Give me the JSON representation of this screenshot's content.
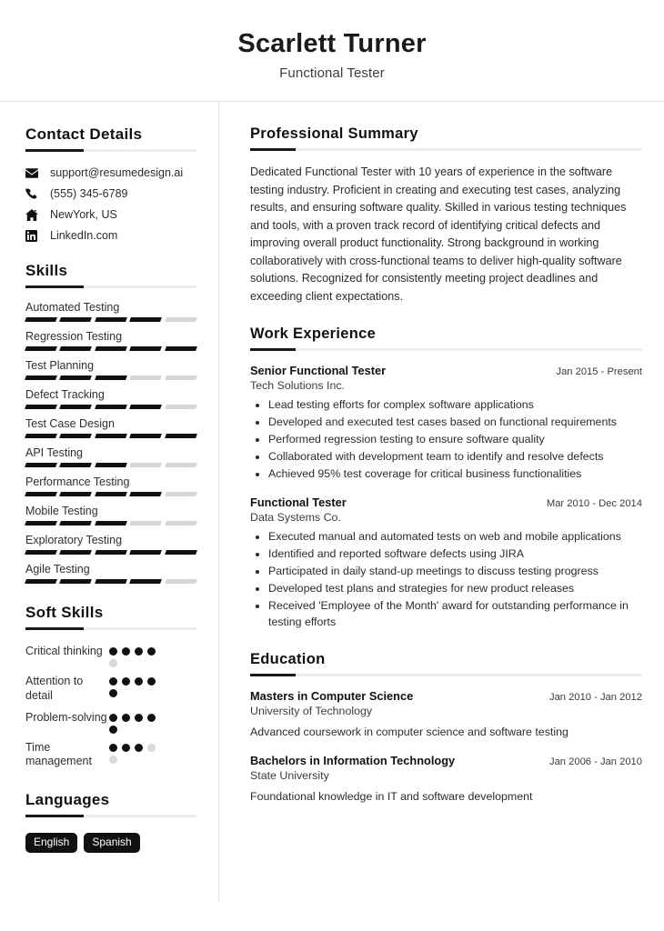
{
  "header": {
    "name": "Scarlett Turner",
    "role": "Functional Tester"
  },
  "sidebar": {
    "contact": {
      "title": "Contact Details",
      "items": [
        {
          "icon": "envelope-icon",
          "text": "support@resumedesign.ai"
        },
        {
          "icon": "phone-icon",
          "text": "(555) 345-6789"
        },
        {
          "icon": "home-icon",
          "text": "NewYork, US"
        },
        {
          "icon": "linkedin-icon",
          "text": "LinkedIn.com"
        }
      ]
    },
    "skills": {
      "title": "Skills",
      "max": 5,
      "items": [
        {
          "name": "Automated Testing",
          "level": 4
        },
        {
          "name": "Regression Testing",
          "level": 5
        },
        {
          "name": "Test Planning",
          "level": 3
        },
        {
          "name": "Defect Tracking",
          "level": 4
        },
        {
          "name": "Test Case Design",
          "level": 5
        },
        {
          "name": "API Testing",
          "level": 3
        },
        {
          "name": "Performance Testing",
          "level": 4
        },
        {
          "name": "Mobile Testing",
          "level": 3
        },
        {
          "name": "Exploratory Testing",
          "level": 5
        },
        {
          "name": "Agile Testing",
          "level": 4
        }
      ]
    },
    "soft_skills": {
      "title": "Soft Skills",
      "max": 5,
      "items": [
        {
          "name": "Critical thinking",
          "level": 4
        },
        {
          "name": "Attention to detail",
          "level": 5
        },
        {
          "name": "Problem-solving",
          "level": 5
        },
        {
          "name": "Time management",
          "level": 3
        }
      ]
    },
    "languages": {
      "title": "Languages",
      "items": [
        "English",
        "Spanish"
      ]
    }
  },
  "main": {
    "summary": {
      "title": "Professional Summary",
      "text": "Dedicated Functional Tester with 10 years of experience in the software testing industry. Proficient in creating and executing test cases, analyzing results, and ensuring software quality. Skilled in various testing techniques and tools, with a proven track record of identifying critical defects and improving overall product functionality. Strong background in working collaboratively with cross-functional teams to deliver high-quality software solutions. Recognized for consistently meeting project deadlines and exceeding client expectations."
    },
    "experience": {
      "title": "Work Experience",
      "entries": [
        {
          "title": "Senior Functional Tester",
          "date": "Jan 2015 - Present",
          "org": "Tech Solutions Inc.",
          "bullets": [
            "Lead testing efforts for complex software applications",
            "Developed and executed test cases based on functional requirements",
            "Performed regression testing to ensure software quality",
            "Collaborated with development team to identify and resolve defects",
            "Achieved 95% test coverage for critical business functionalities"
          ]
        },
        {
          "title": "Functional Tester",
          "date": "Mar 2010 - Dec 2014",
          "org": "Data Systems Co.",
          "bullets": [
            "Executed manual and automated tests on web and mobile applications",
            "Identified and reported software defects using JIRA",
            "Participated in daily stand-up meetings to discuss testing progress",
            "Developed test plans and strategies for new product releases",
            "Received 'Employee of the Month' award for outstanding performance in testing efforts"
          ]
        }
      ]
    },
    "education": {
      "title": "Education",
      "entries": [
        {
          "title": "Masters in Computer Science",
          "date": "Jan 2010 - Jan 2012",
          "org": "University of Technology",
          "desc": "Advanced coursework in computer science and software testing"
        },
        {
          "title": "Bachelors in Information Technology",
          "date": "Jan 2006 - Jan 2010",
          "org": "State University",
          "desc": "Foundational knowledge in IT and software development"
        }
      ]
    }
  }
}
